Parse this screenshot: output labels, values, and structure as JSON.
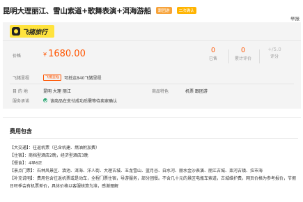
{
  "product": {
    "title": "昆明大理丽江、雪山索道+歌舞表演+洱海游船",
    "tags": [
      "跟团游",
      "二次确认"
    ],
    "report": "举报"
  },
  "brand": {
    "logo_text": "飞猪旅行"
  },
  "price_section": {
    "label": "价格",
    "currency": "¥",
    "amount": "1680.00",
    "sold": {
      "value": "0",
      "caption": "已售"
    },
    "reviews": {
      "value": "0",
      "caption": "累计评价"
    },
    "rating": {
      "value": "+/5.0",
      "caption": "评分"
    }
  },
  "points": {
    "label": "飞猪里程",
    "badge": "飞猪里程",
    "text": "可抵这840飞猪里程"
  },
  "info": {
    "destination_label": "目 的 地",
    "destinations": "昆明  大理  丽江",
    "features_label": "商品特色",
    "features": "机票  跟团游"
  },
  "service": {
    "label": "服务承诺",
    "text": "该商品在支付成功后需等待卖家确认"
  },
  "fees": {
    "title": "费用包含",
    "lines": [
      "【大交通】：往返机票（已含机建、燃油附加费）",
      "【住宿】：商档型酒店2晚，经济型酒店3晚",
      "【餐食】：4早6正",
      "【景点门票】：石林风景区、滇池、洱海、洋人街、大理古城、玉龙雪山、蓝月谷、白水河、丽水金沙表演、丽江古城、束河古镇、拉市海",
      "【补充说明】：费用包含往返机票或是动车，全程门票住宿，导游服务，部分团餐。不含几十元的景区电瓶车索道，古城维护费。网页价格为参考报价，节假日旺季会有机票差价，具体价格以客服核算为准，感谢理解"
    ]
  }
}
